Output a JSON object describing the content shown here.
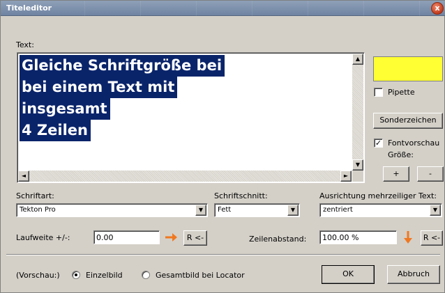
{
  "window": {
    "title": "Titeleditor",
    "close_glyph": "x"
  },
  "text_section": {
    "label": "Text:",
    "lines": [
      "Gleiche Schriftgröße bei",
      "bei einem Text mit",
      "insgesamt",
      "4 Zeilen"
    ],
    "selection_color": "#0a246a"
  },
  "color_preview": {
    "color": "#ffff33"
  },
  "pipette": {
    "label": "Pipette",
    "checked": false
  },
  "sonderzeichen_button": {
    "label": "Sonderzeichen"
  },
  "fontvorschau": {
    "label": "Fontvorschau",
    "checked": true,
    "check_glyph": "✓"
  },
  "groesse": {
    "label": "Größe:",
    "plus": "+",
    "minus": "-"
  },
  "schriftart": {
    "label": "Schriftart:",
    "value": "Tekton Pro"
  },
  "schriftschnitt": {
    "label": "Schriftschnitt:",
    "value": "Fett"
  },
  "ausrichtung": {
    "label": "Ausrichtung mehrzeiliger Text:",
    "value": "zentriert"
  },
  "laufweite": {
    "label": "Laufweite +/-:",
    "value": "0.00",
    "reset": "R <-"
  },
  "zeilenabstand": {
    "label": "Zeilenabstand:",
    "value": "100.00 %",
    "reset": "R <-"
  },
  "vorschau": {
    "label": "(Vorschau:)",
    "options": [
      "Einzelbild",
      "Gesamtbild bei Locator"
    ],
    "selected": "Einzelbild"
  },
  "buttons": {
    "ok": "OK",
    "cancel": "Abbruch"
  },
  "icons": {
    "scroll_up": "▲",
    "scroll_down": "▼",
    "scroll_left": "◄",
    "scroll_right": "►",
    "dropdown": "▼",
    "arrow_right": "arrow-right-icon",
    "arrow_down": "arrow-down-icon"
  },
  "accent_color": "#f07820"
}
